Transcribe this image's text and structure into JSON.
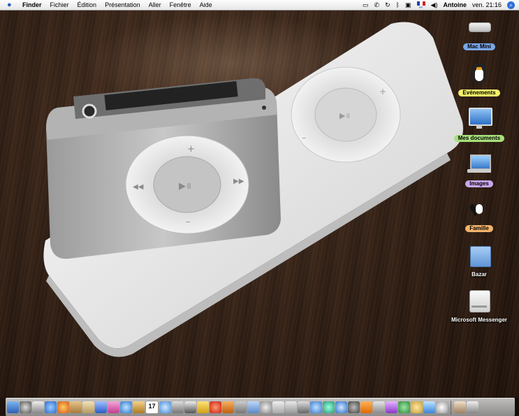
{
  "menubar": {
    "app": "Finder",
    "menus": [
      "Fichier",
      "Édition",
      "Présentation",
      "Aller",
      "Fenêtre",
      "Aide"
    ],
    "user": "Antoine",
    "clock": "ven. 21:16",
    "flag_code": "FR"
  },
  "desktop": {
    "icons": [
      {
        "label": "Mac Mini",
        "label_color": "#7aa7e6"
      },
      {
        "label": "Evénements",
        "label_color": "#f4f06a"
      },
      {
        "label": "Mes documents",
        "label_color": "#a8e07a"
      },
      {
        "label": "Images",
        "label_color": "#c9a7ea"
      },
      {
        "label": "Famille",
        "label_color": "#f3b36a"
      },
      {
        "label": "Bazar",
        "label_color": ""
      },
      {
        "label": "Microsoft Messenger",
        "label_color": ""
      }
    ]
  },
  "calendar_dock_day": "17"
}
